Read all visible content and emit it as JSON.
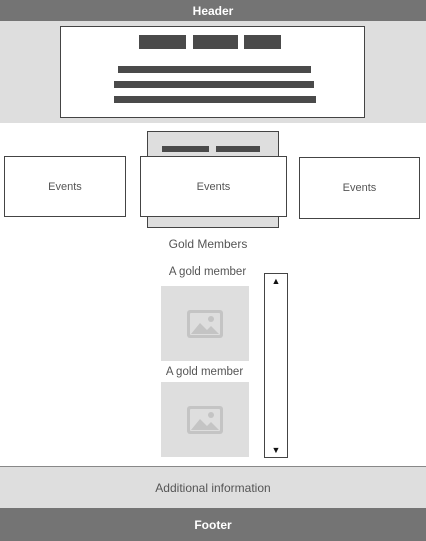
{
  "header": {
    "title": "Header"
  },
  "footer": {
    "title": "Footer"
  },
  "events": {
    "cards": [
      {
        "label": "Events"
      },
      {
        "label": "Events"
      },
      {
        "label": "Events"
      }
    ]
  },
  "gold_members": {
    "title": "Gold Members",
    "members": [
      {
        "label": "A gold member",
        "icon": "image-placeholder-icon"
      },
      {
        "label": "A gold member",
        "icon": "image-placeholder-icon"
      }
    ],
    "scroll_up": "▲",
    "scroll_down": "▼"
  },
  "additional": {
    "label": "Additional information"
  },
  "colors": {
    "bar": "#747474",
    "panel": "#dedede",
    "placeholder_block": "#4a4a4a"
  }
}
